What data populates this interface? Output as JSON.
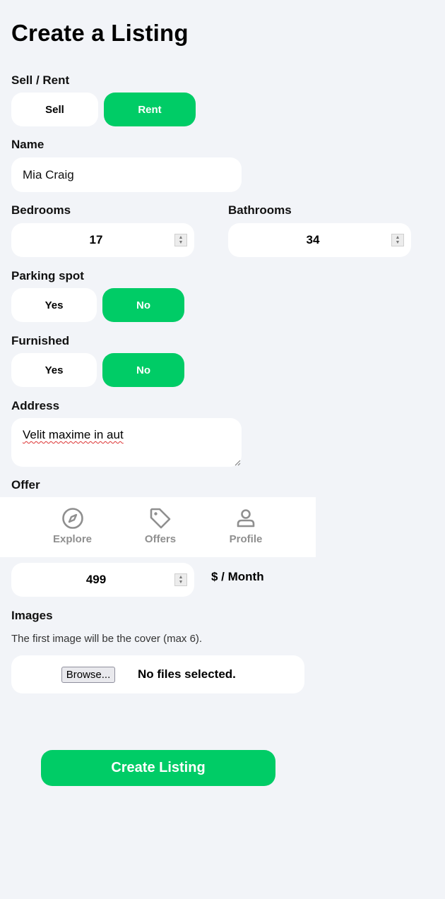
{
  "page": {
    "title": "Create a Listing"
  },
  "type": {
    "label": "Sell / Rent",
    "options": [
      "Sell",
      "Rent"
    ],
    "selected": "Rent"
  },
  "name": {
    "label": "Name",
    "value": "Mia Craig"
  },
  "bedrooms": {
    "label": "Bedrooms",
    "value": "17"
  },
  "bathrooms": {
    "label": "Bathrooms",
    "value": "34"
  },
  "parking": {
    "label": "Parking spot",
    "options": [
      "Yes",
      "No"
    ],
    "selected": "No"
  },
  "furnished": {
    "label": "Furnished",
    "options": [
      "Yes",
      "No"
    ],
    "selected": "No"
  },
  "address": {
    "label": "Address",
    "value": "Velit maxime in aut"
  },
  "offer": {
    "label": "Offer"
  },
  "nav": {
    "items": [
      {
        "label": "Explore",
        "icon": "compass-icon"
      },
      {
        "label": "Offers",
        "icon": "tag-icon"
      },
      {
        "label": "Profile",
        "icon": "person-icon"
      }
    ]
  },
  "price": {
    "value": "499",
    "unit": "$ / Month"
  },
  "images": {
    "label": "Images",
    "hint": "The first image will be the cover (max 6).",
    "browse_label": "Browse...",
    "status": "No files selected."
  },
  "submit": {
    "label": "Create Listing"
  },
  "colors": {
    "accent": "#00cc66",
    "background": "#f2f4f8",
    "nav_icon": "#8f8f8f"
  }
}
